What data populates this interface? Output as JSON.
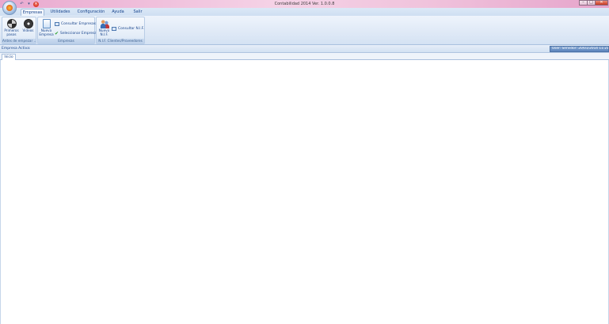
{
  "window": {
    "title": "Contabilidad 2014  Ver. 1.0.0.8",
    "controls": {
      "minimize": "–",
      "maximize": "□",
      "close": "✕"
    }
  },
  "quick_access": {
    "undo_glyph": "↶",
    "dropdown_glyph": "▾",
    "exit_glyph": "✕"
  },
  "tabs": [
    {
      "label": "Empresas",
      "active": true
    },
    {
      "label": "Utilidades",
      "active": false
    },
    {
      "label": "Configuración",
      "active": false
    },
    {
      "label": "Ayuda",
      "active": false
    },
    {
      "label": "Salir",
      "active": false
    }
  ],
  "ribbon": {
    "groups": [
      {
        "label": "Antes de empezar ...",
        "buttons": [
          {
            "label_line1": "Primeros",
            "label_line2": "pasos",
            "icon": "lifebuoy-icon"
          },
          {
            "label_line1": "Videos",
            "label_line2": "",
            "icon": "film-reel-icon"
          }
        ]
      },
      {
        "label": "Empresas",
        "big_button": {
          "label_line1": "Nueva",
          "label_line2": "Empresa",
          "icon": "new-document-icon"
        },
        "small_buttons": [
          {
            "label": "Consultar Empresas",
            "icon": "search-window-icon"
          },
          {
            "label": "Seleccionar Empresa",
            "icon": "checkmark-icon"
          }
        ]
      },
      {
        "label": "N.I.F. Clientes/Proveedores",
        "big_button": {
          "label_line1": "Nuevo",
          "label_line2": "N.I.F.",
          "icon": "users-icon"
        },
        "small_buttons": [
          {
            "label": "Consultar N.I.F.",
            "icon": "search-window-icon"
          }
        ]
      }
    ]
  },
  "infobar": {
    "label": "Empresa Activa:",
    "server_text": "User:   Servidor:  20/01/2014 11:21"
  },
  "document_tabs": [
    {
      "label": "Inicio"
    }
  ],
  "colors": {
    "titlebar": "#f0c3dc",
    "ribbon": "#dfe9f6",
    "accent_text": "#15428b",
    "server_box": "#6d93c6"
  }
}
